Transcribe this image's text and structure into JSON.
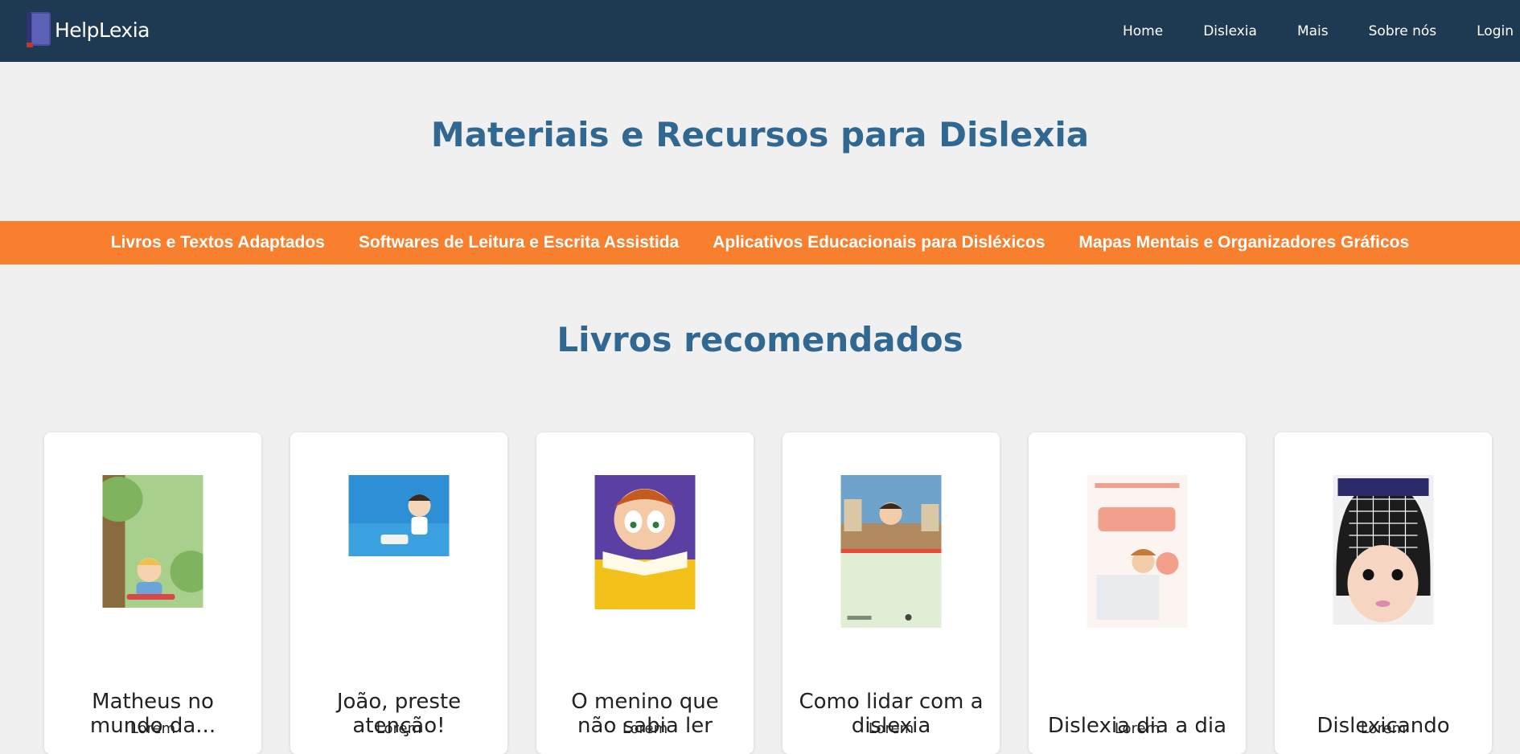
{
  "brand": {
    "name": "HelpLexia"
  },
  "nav": [
    "Home",
    "Dislexia",
    "Mais",
    "Sobre nós",
    "Login"
  ],
  "page": {
    "title": "Materiais e Recursos para Dislexia"
  },
  "tabs": [
    "Livros e Textos Adaptados",
    "Softwares de Leitura e Escrita Assistida",
    "Aplicativos Educacionais para Disléxicos",
    "Mapas Mentais e Organizadores Gráficos"
  ],
  "section": {
    "title": "Livros recomendados"
  },
  "books": [
    {
      "title": "Matheus no mundo da...",
      "text": "Lorem"
    },
    {
      "title": "João, preste atenção!",
      "text": "Lorem"
    },
    {
      "title": "O menino que não sabia ler",
      "text": "Lorem"
    },
    {
      "title": "Como lidar com a dislexia",
      "text": "Lorem"
    },
    {
      "title": "Dislexia dia a dia",
      "text": "Lorem"
    },
    {
      "title": "Dislexicando",
      "text": "Lorem"
    }
  ],
  "colors": {
    "navbar": "#1e3a52",
    "accent": "#f77f2e",
    "heading": "#316891",
    "background": "#f0f0f0"
  }
}
